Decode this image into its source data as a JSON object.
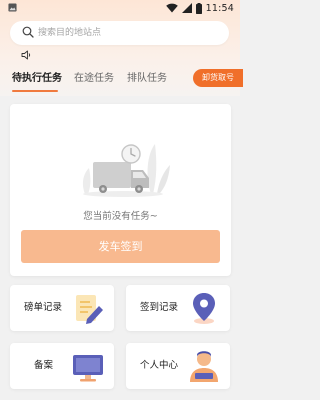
{
  "status_bar": {
    "time": "11:54"
  },
  "search": {
    "placeholder": "搜索目的地站点"
  },
  "tabs": [
    {
      "label": "待执行任务",
      "active": true
    },
    {
      "label": "在途任务",
      "active": false
    },
    {
      "label": "排队任务",
      "active": false
    }
  ],
  "pickup_button": {
    "label": "卸货取号"
  },
  "empty_state": {
    "text": "您当前没有任务~"
  },
  "checkin_button": {
    "label": "发车签到"
  },
  "menu": [
    {
      "label": "磅单记录",
      "icon": "document-pen-icon"
    },
    {
      "label": "签到记录",
      "icon": "location-pin-icon"
    },
    {
      "label": "备案",
      "icon": "monitor-icon"
    },
    {
      "label": "个人中心",
      "icon": "person-icon"
    }
  ],
  "colors": {
    "accent": "#f06f2a",
    "button_light": "#f8b98f",
    "tab_underline": "#f07a3e"
  }
}
